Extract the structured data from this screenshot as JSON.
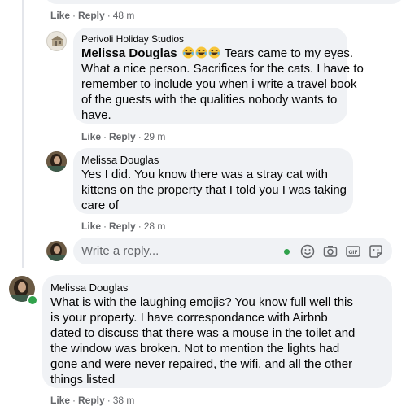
{
  "comments": [
    {
      "meta": {
        "like": "Like",
        "reply": "Reply",
        "time": "48 m"
      }
    },
    {
      "page_name": "Perivoli Holiday Studios",
      "author": "Melissa Douglas",
      "emojis": [
        "rolling-on-floor-laughing-emoji",
        "rolling-on-floor-laughing-emoji",
        "rolling-on-floor-laughing-emoji"
      ],
      "lines": [
        "Tears came to my eyes.",
        "What a nice person. Sacrifices for the cats. I have to",
        "remember to include you when i write a travel book",
        "of the guests with the qualities nobody wants to",
        "have."
      ],
      "meta": {
        "like": "Like",
        "reply": "Reply",
        "time": "29 m"
      }
    },
    {
      "author": "Melissa Douglas",
      "lines": [
        "Yes I did. You know there was a stray cat with",
        "kittens on the property that I told you I was taking",
        "care of"
      ],
      "meta": {
        "like": "Like",
        "reply": "Reply",
        "time": "28 m"
      }
    },
    {
      "author": "Melissa Douglas",
      "lines": [
        "What is with the laughing emojis? You know full well this",
        "is your property. I have correspondance with Airbnb",
        "dated to discuss that there was a mouse in the toilet and",
        "the window was broken. Not to mention the lights had",
        "gone and were never repaired, the wifi, and all the other",
        "things listed"
      ],
      "meta": {
        "like": "Like",
        "reply": "Reply",
        "time": "38 m"
      }
    }
  ],
  "reply_box": {
    "placeholder": "Write a reply...",
    "icons": [
      "emoji-icon",
      "camera-icon",
      "gif-icon",
      "sticker-icon"
    ]
  },
  "colors": {
    "bubble": "#f0f2f5",
    "meta_text": "#65676b",
    "online": "#31a24c"
  }
}
